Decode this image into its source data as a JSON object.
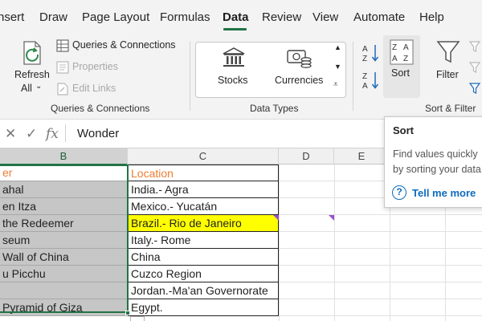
{
  "tabs": [
    {
      "label": "nsert"
    },
    {
      "label": "Draw"
    },
    {
      "label": "Page Layout"
    },
    {
      "label": "Formulas"
    },
    {
      "label": "Data"
    },
    {
      "label": "Review"
    },
    {
      "label": "View"
    },
    {
      "label": "Automate"
    },
    {
      "label": "Help"
    }
  ],
  "active_tab": "Data",
  "ribbon": {
    "refresh_all_line1": "Refresh",
    "refresh_all_line2": "All",
    "queries_connections": "Queries & Connections",
    "properties": "Properties",
    "edit_links": "Edit Links",
    "group_queries": "Queries & Connections",
    "stocks": "Stocks",
    "currencies": "Currencies",
    "group_data_types": "Data Types",
    "sort": "Sort",
    "filter": "Filter",
    "group_sort_filter": "Sort & Filter",
    "sort_az_glyph": "A Z",
    "sort_za_glyph": "Z A",
    "sort_big_glyph": "Z A"
  },
  "formula_bar": {
    "cancel_glyph": "✕",
    "enter_glyph": "✓",
    "fx_glyph": "fx",
    "value": "Wonder"
  },
  "columns": [
    "B",
    "C",
    "D",
    "E"
  ],
  "selected_column": "B",
  "table": {
    "header_b": "er",
    "header_c": "Location",
    "rows": [
      {
        "b": "ahal",
        "c": "India.- Agra"
      },
      {
        "b": "en Itza",
        "c": "Mexico.- Yucatán"
      },
      {
        "b": " the Redeemer",
        "c": "Brazil.- Rio de Janeiro"
      },
      {
        "b": "seum",
        "c": "Italy.- Rome"
      },
      {
        "b": " Wall of China",
        "c": "China"
      },
      {
        "b": "u Picchu",
        "c": "Cuzco Region"
      },
      {
        "b": "",
        "c": "Jordan.-Ma'an Governorate"
      },
      {
        "b": " Pyramid of Giza",
        "c": "Egypt."
      }
    ]
  },
  "tooltip": {
    "title": "Sort",
    "description": "Find values quickly by sorting your data.",
    "help_glyph": "?",
    "help_link": "Tell me more"
  },
  "colors": {
    "accent": "#217346",
    "header_text": "#ed7d31",
    "highlight": "#ffff00",
    "comment_marker": "#9b4fc9",
    "link": "#0f6cbd"
  }
}
